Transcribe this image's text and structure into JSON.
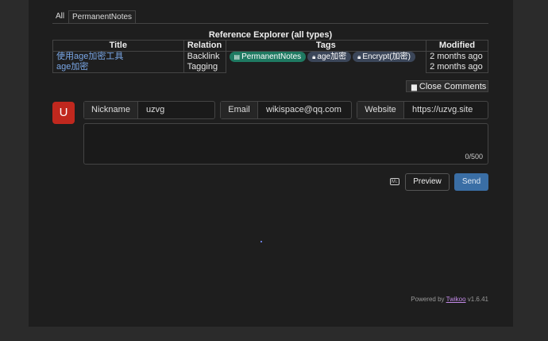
{
  "tabs": [
    {
      "label": "All"
    },
    {
      "label": "PermanentNotes"
    }
  ],
  "reference": {
    "title": "Reference Explorer (all types)",
    "columns": [
      "Title",
      "Relation",
      "Tags",
      "Modified"
    ],
    "rows": [
      {
        "title": "使用age加密工具",
        "relation": "Backlink",
        "modified": "2 months ago"
      },
      {
        "title": "age加密",
        "relation": "Tagging",
        "modified": "2 months ago"
      }
    ],
    "tags": [
      {
        "label": "PermanentNotes",
        "icon": "notes-icon"
      },
      {
        "label": "age加密",
        "icon": "lock-icon"
      },
      {
        "label": "Encrypt(加密)",
        "icon": "lock-icon"
      }
    ]
  },
  "comments": {
    "close_label": "Close Comments",
    "avatar_letter": "U",
    "nickname_label": "Nickname",
    "nickname_value": "uzvg",
    "email_label": "Email",
    "email_value": "wikispace@qq.com",
    "website_label": "Website",
    "website_value": "https://uzvg.site",
    "counter": "0/500",
    "markdown_icon": "M↓",
    "preview_label": "Preview",
    "send_label": "Send"
  },
  "footer": {
    "powered_prefix": "Powered by ",
    "powered_link": "Twikoo",
    "version": " v1.6.41"
  },
  "colors": {
    "accent": "#3a6ea5",
    "avatar": "#c0281e",
    "tag_green": "#1f7a62",
    "tag_dark": "#3b4659"
  }
}
